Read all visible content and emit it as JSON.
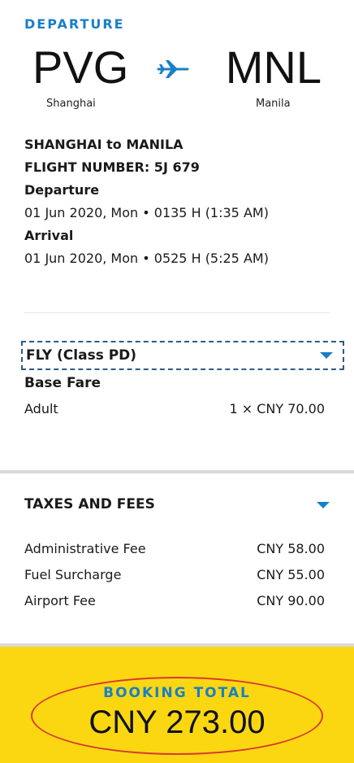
{
  "departure": {
    "label": "DEPARTURE",
    "origin_code": "PVG",
    "origin_city": "Shanghai",
    "destination_code": "MNL",
    "destination_city": "Manila",
    "route_title": "SHANGHAI to MANILA",
    "flight_number": "FLIGHT NUMBER: 5J 679",
    "departure_label": "Departure",
    "departure_time": "01 Jun 2020, Mon • 0135 H (1:35 AM)",
    "arrival_label": "Arrival",
    "arrival_time": "01 Jun 2020, Mon • 0525 H (5:25 AM)",
    "icon": "plane-icon"
  },
  "fare": {
    "class_title": "FLY (Class PD)",
    "base_fare_label": "Base Fare",
    "adult_label": "Adult",
    "adult_value": "1 × CNY 70.00"
  },
  "taxes": {
    "title": "TAXES AND FEES",
    "items": [
      {
        "label": "Administrative Fee",
        "value": "CNY 58.00"
      },
      {
        "label": "Fuel Surcharge",
        "value": "CNY 55.00"
      },
      {
        "label": "Airport Fee",
        "value": "CNY 90.00"
      }
    ]
  },
  "total": {
    "label": "BOOKING TOTAL",
    "amount": "CNY 273.00"
  },
  "colors": {
    "accent": "#1a7fc6",
    "total_background": "#fbd712",
    "highlight_ring": "#d93a2e"
  }
}
